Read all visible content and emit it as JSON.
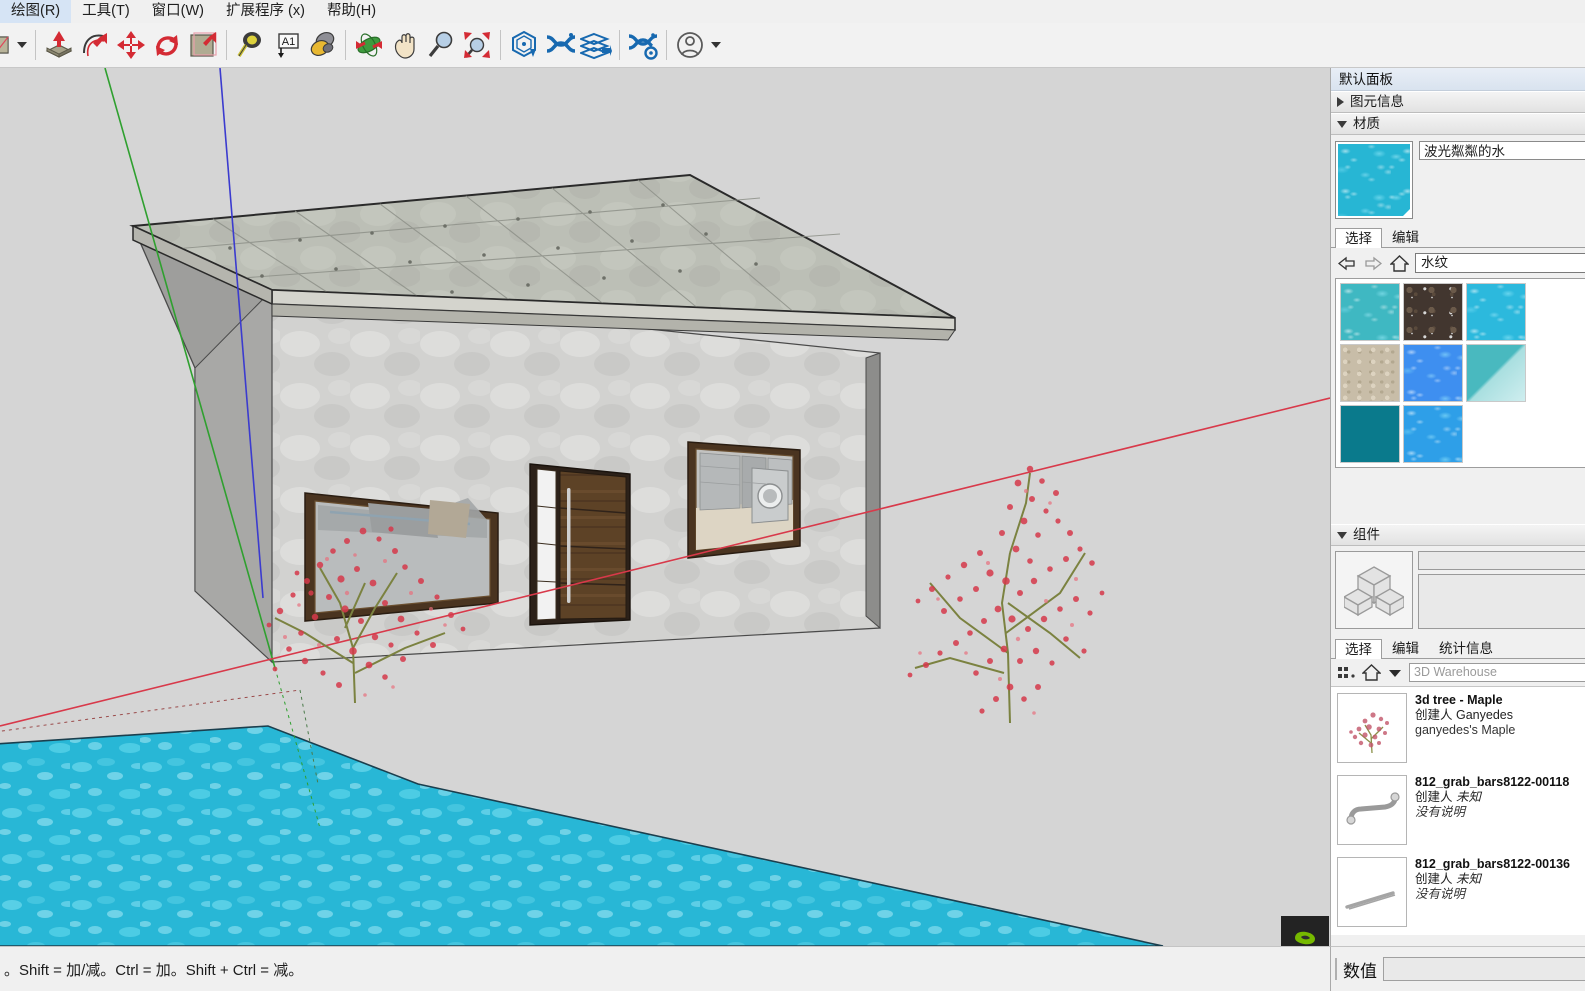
{
  "menu": {
    "items": [
      {
        "label": "绘图(R)",
        "key": "R"
      },
      {
        "label": "工具(T)",
        "key": "T"
      },
      {
        "label": "窗口(W)",
        "key": "W"
      },
      {
        "label": "扩展程序 (x)",
        "key": "x"
      },
      {
        "label": "帮助(H)",
        "key": "H"
      }
    ]
  },
  "toolbar": {
    "tools": [
      {
        "name": "select-tool",
        "label": "选择"
      },
      {
        "name": "dropdown-caret",
        "label": "▼"
      },
      {
        "name": "push-pull-tool",
        "label": "推/拉"
      },
      {
        "name": "follow-me-tool",
        "label": "路径跟随"
      },
      {
        "name": "move-tool",
        "label": "移动"
      },
      {
        "name": "rotate-tool",
        "label": "旋转"
      },
      {
        "name": "offset-tool",
        "label": "偏移"
      },
      {
        "name": "tape-measure-tool",
        "label": "卷尺"
      },
      {
        "name": "text-tool",
        "label": "文字"
      },
      {
        "name": "paint-bucket-tool",
        "label": "材料桶"
      },
      {
        "name": "orbit-tool",
        "label": "环绕观察"
      },
      {
        "name": "pan-tool",
        "label": "平移"
      },
      {
        "name": "zoom-tool",
        "label": "缩放"
      },
      {
        "name": "zoom-extents-tool",
        "label": "充满视窗"
      },
      {
        "name": "extension-solid-tool",
        "label": "实体工具"
      },
      {
        "name": "extension-mesh-tool",
        "label": "网格工具"
      },
      {
        "name": "extension-layer-tool",
        "label": "图层工具"
      },
      {
        "name": "extension-settings-tool",
        "label": "设置"
      },
      {
        "name": "account-button",
        "label": "账户"
      }
    ]
  },
  "tray": {
    "title": "默认面板",
    "sections": {
      "entity_info": {
        "label": "图元信息",
        "expanded": false
      },
      "materials": {
        "label": "材质",
        "expanded": true
      },
      "components": {
        "label": "组件",
        "expanded": true
      }
    },
    "materials": {
      "current_name": "波光粼粼的水",
      "swatch_color": "#2bb8d8",
      "tabs": [
        {
          "label": "选择",
          "active": true
        },
        {
          "label": "编辑",
          "active": false
        }
      ],
      "collection": "水纹",
      "nav": {
        "back": "back-arrow-icon",
        "forward": "forward-arrow-icon",
        "home": "home-icon"
      },
      "swatches": [
        {
          "name": "pool-water-turquoise",
          "color": "#3fb8c2"
        },
        {
          "name": "dark-rock-water",
          "color": "#42362f"
        },
        {
          "name": "bright-cyan-water",
          "color": "#2cb9dd"
        },
        {
          "name": "sand-beige",
          "color": "#c8bda8"
        },
        {
          "name": "blue-pool-ripple",
          "color": "#3e8ff0"
        },
        {
          "name": "shallow-shore-water",
          "color": "#6fc9c9"
        },
        {
          "name": "deep-teal-water",
          "color": "#0a7a8c"
        },
        {
          "name": "light-blue-water",
          "color": "#2e9fe8"
        }
      ]
    },
    "components": {
      "preview_icon": "components-cubes-icon",
      "tabs": [
        {
          "label": "选择",
          "active": true
        },
        {
          "label": "编辑",
          "active": false
        },
        {
          "label": "统计信息",
          "active": false
        }
      ],
      "warehouse_placeholder": "3D Warehouse",
      "view_icon": "grid-view-icon",
      "home_icon": "home-icon",
      "results": [
        {
          "title": "3d tree - Maple",
          "author_label": "创建人",
          "author": "Ganyedes",
          "description": "ganyedes's Maple",
          "thumb": "maple-tree-thumb"
        },
        {
          "title": "812_grab_bars8122-00118",
          "author_label": "创建人",
          "author": "未知",
          "description": "没有说明",
          "thumb": "grab-bar-thumb"
        },
        {
          "title": "812_grab_bars8122-00136",
          "author_label": "创建人",
          "author": "未知",
          "description": "没有说明",
          "thumb": "grab-bar-thin-thumb"
        }
      ]
    }
  },
  "statusbar": {
    "hint": "。Shift = 加/减。Ctrl = 加。Shift + Ctrl = 减。"
  },
  "vcb": {
    "label": "数值",
    "value": ""
  },
  "scene": {
    "background": "#d5d5d5",
    "axes": {
      "red": "#d8394a",
      "green": "#2fa02f",
      "blue": "#3b3bcf"
    },
    "model": {
      "roof_material": "concrete-panel",
      "wall_material": "white-stucco",
      "door_material": "dark-wood",
      "window_frame": "brown-frame",
      "water_material": "波光粼粼的水",
      "trees": 2
    }
  }
}
